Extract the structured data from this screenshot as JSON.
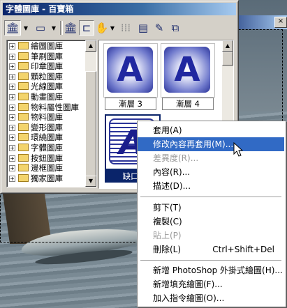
{
  "window": {
    "title": "字體圖庫 - 百寶箱"
  },
  "tree": {
    "items": [
      "繪圖圖庫",
      "筆刷圖庫",
      "印章圖庫",
      "顆粒圖庫",
      "光線圖庫",
      "動畫圖庫",
      "物料屬性圖庫",
      "物料圖庫",
      "變形圖庫",
      "環繞圖庫",
      "字體圖庫",
      "按鈕圖庫",
      "邊框圖庫",
      "獨家圖庫"
    ]
  },
  "gallery": {
    "items": [
      {
        "glyph": "A",
        "label": "漸層 3"
      },
      {
        "glyph": "A",
        "label": "漸層 4"
      },
      {
        "glyph": "A",
        "label": "缺口"
      }
    ]
  },
  "context_menu": {
    "items": [
      {
        "label": "套用(A)",
        "shortcut": "",
        "enabled": true,
        "highlighted": false
      },
      {
        "label": "修改內容再套用(M)...",
        "shortcut": "",
        "enabled": true,
        "highlighted": true
      },
      {
        "label": "差異度(R)...",
        "shortcut": "",
        "enabled": false,
        "highlighted": false
      },
      {
        "label": "內容(R)...",
        "shortcut": "",
        "enabled": true,
        "highlighted": false
      },
      {
        "label": "描述(D)...",
        "shortcut": "",
        "enabled": true,
        "highlighted": false
      },
      {
        "label": "剪下(T)",
        "shortcut": "",
        "enabled": true,
        "highlighted": false
      },
      {
        "label": "複製(C)",
        "shortcut": "",
        "enabled": true,
        "highlighted": false
      },
      {
        "label": "貼上(P)",
        "shortcut": "",
        "enabled": false,
        "highlighted": false
      },
      {
        "label": "刪除(L)",
        "shortcut": "Ctrl+Shift+Del",
        "enabled": true,
        "highlighted": false
      },
      {
        "label": "新增 PhotoShop 外掛式繪圖(H)...",
        "shortcut": "",
        "enabled": true,
        "highlighted": false
      },
      {
        "label": "新增填充繪圖(F)...",
        "shortcut": "",
        "enabled": true,
        "highlighted": false
      },
      {
        "label": "加入指令繪圖(O)...",
        "shortcut": "",
        "enabled": true,
        "highlighted": false
      }
    ]
  },
  "background": {
    "close_glyph": "×"
  }
}
